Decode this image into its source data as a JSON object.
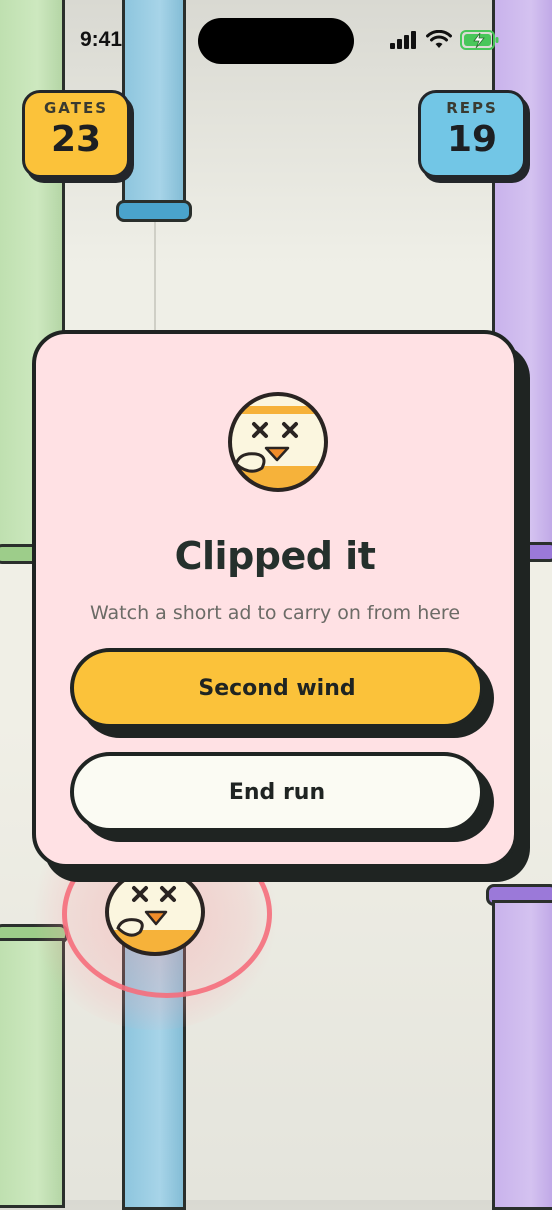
{
  "status_bar": {
    "time": "9:41"
  },
  "hud": {
    "gates": {
      "label": "GATES",
      "value": "23"
    },
    "reps": {
      "label": "REPS",
      "value": "19"
    }
  },
  "modal": {
    "title": "Clipped it",
    "subtitle": "Watch a short ad to carry on from here",
    "primary_button": "Second wind",
    "secondary_button": "End run"
  },
  "colors": {
    "gates_badge": "#fbc23a",
    "reps_badge": "#72c6e6",
    "modal_bg": "#ffe1e4",
    "primary_button": "#fbc23a",
    "secondary_button": "#fbfbf3",
    "pipe_green": "#bfe0b0",
    "pipe_blue": "#8ec6de",
    "pipe_purple": "#c9b3ec"
  }
}
